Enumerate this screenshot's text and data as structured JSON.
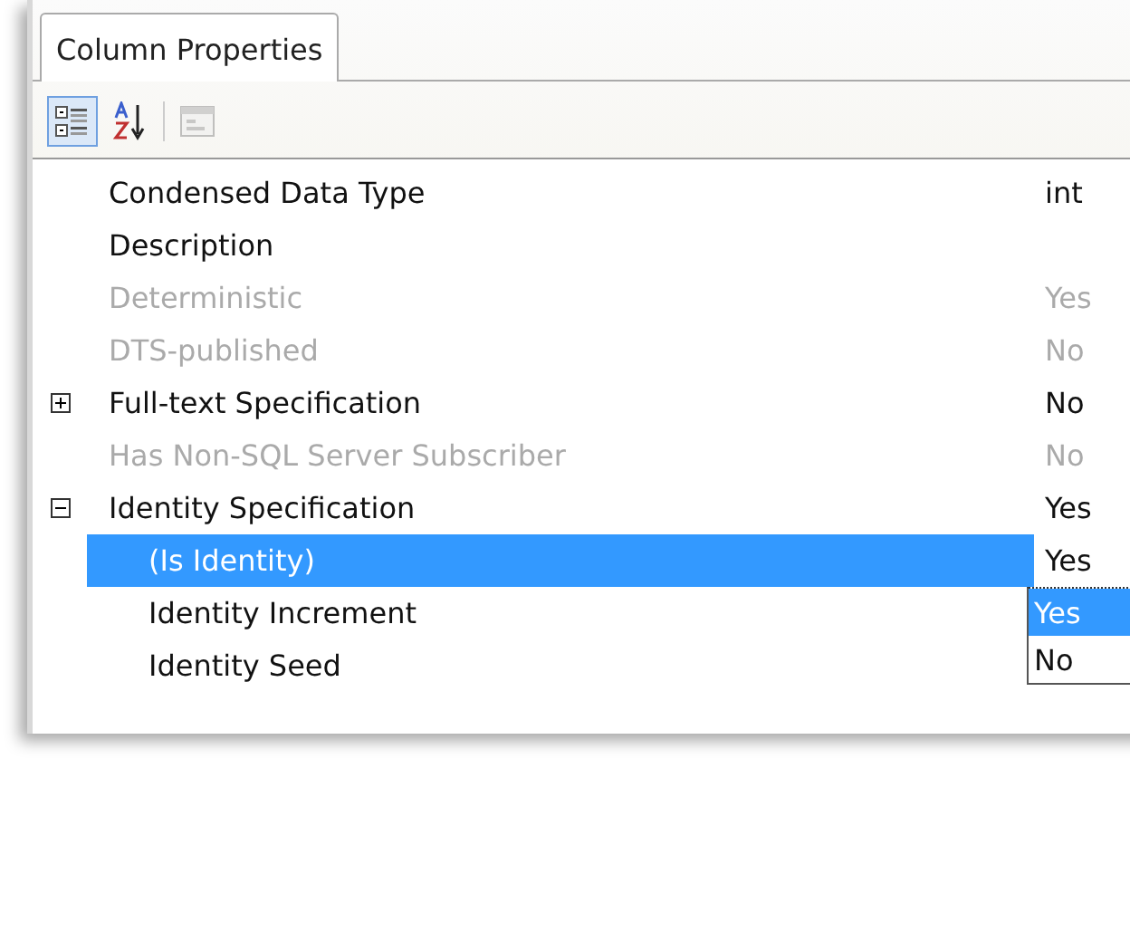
{
  "tab": {
    "label": "Column Properties",
    "selected": true
  },
  "toolbar": [
    {
      "kind": "categorized",
      "selected": true,
      "disabled": false
    },
    {
      "kind": "alphabetical",
      "selected": false,
      "disabled": false
    },
    {
      "kind": "property-pages",
      "selected": false,
      "disabled": true
    }
  ],
  "properties": [
    {
      "label": "Condensed Data Type",
      "value": "int",
      "disabled": false,
      "selected": false
    },
    {
      "label": "Description",
      "disabled": false,
      "selected": false
    },
    {
      "label": "Deterministic",
      "value": "Yes",
      "disabled": true,
      "selected": false
    },
    {
      "label": "DTS-published",
      "value": "No",
      "disabled": true,
      "selected": false
    },
    {
      "label": "Full-text Specification",
      "value": "No",
      "disabled": false,
      "selected": false,
      "expanded": false
    },
    {
      "label": "Has Non-SQL Server Subscriber",
      "value": "No",
      "disabled": true,
      "selected": false
    },
    {
      "label": "Identity Specification",
      "value": "Yes",
      "disabled": false,
      "selected": false,
      "expanded": true,
      "children": [
        {
          "label": "(Is Identity)",
          "value": "Yes",
          "disabled": false,
          "selected": true
        },
        {
          "label": "Identity Increment",
          "disabled": false,
          "selected": false
        },
        {
          "label": "Identity Seed",
          "disabled": false,
          "selected": false
        }
      ]
    }
  ],
  "dropdown": {
    "options": [
      {
        "label": "Yes",
        "selected": true
      },
      {
        "label": "No",
        "selected": false
      }
    ]
  }
}
